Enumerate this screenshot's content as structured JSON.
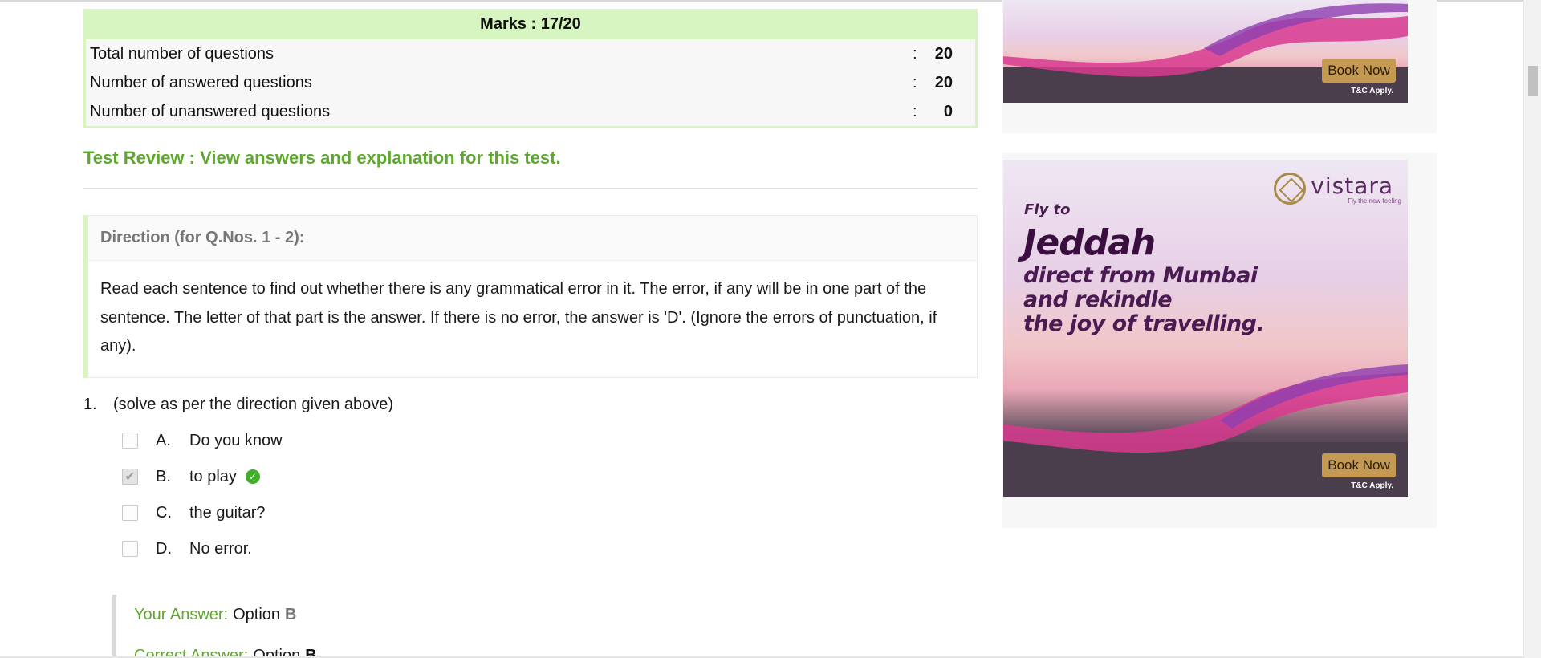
{
  "marks": {
    "title": "Marks : 17/20",
    "rows": [
      {
        "label": "Total number of questions",
        "colon": ":",
        "value": "20"
      },
      {
        "label": "Number of answered questions",
        "colon": ":",
        "value": "20"
      },
      {
        "label": "Number of unanswered questions",
        "colon": ":",
        "value": "0"
      }
    ]
  },
  "review_link": "Test Review : View answers and explanation for this test.",
  "direction": {
    "title": "Direction (for Q.Nos. 1 - 2):",
    "body": "Read each sentence to find out whether there is any grammatical error in it. The error, if any will be in one part of the sentence. The letter of that part is the answer. If there is no error, the answer is 'D'. (Ignore the errors of punctuation, if any)."
  },
  "question": {
    "number": "1.",
    "text": "(solve as per the direction given above)",
    "options": [
      {
        "letter": "A.",
        "text": "Do you know",
        "checked": false
      },
      {
        "letter": "B.",
        "text": "to play",
        "checked": true
      },
      {
        "letter": "C.",
        "text": "the guitar?",
        "checked": false
      },
      {
        "letter": "D.",
        "text": "No error.",
        "checked": false
      }
    ],
    "your_answer_label": "Your Answer:",
    "your_answer_prefix": "Option",
    "your_answer_value": "B",
    "correct_answer_label": "Correct Answer:",
    "correct_answer_prefix": "Option",
    "correct_answer_value": "B"
  },
  "ads": {
    "fly": "Fly to",
    "city": "Jeddah",
    "tagline_1": "direct from Mumbai",
    "tagline_2": "and rekindle",
    "tagline_3": "the joy of travelling.",
    "brand": "vistara",
    "brand_sub": "Fly the new feeling",
    "button": "Book Now",
    "tc": "T&C Apply."
  },
  "colors": {
    "accent_green": "#5ea82d",
    "marks_header_bg": "#d6f5c0",
    "correct_icon": "#3fae28",
    "ad_button": "#c49a52"
  },
  "icons": [
    "checkbox-icon",
    "check-circle-icon",
    "vistara-logo-icon"
  ]
}
